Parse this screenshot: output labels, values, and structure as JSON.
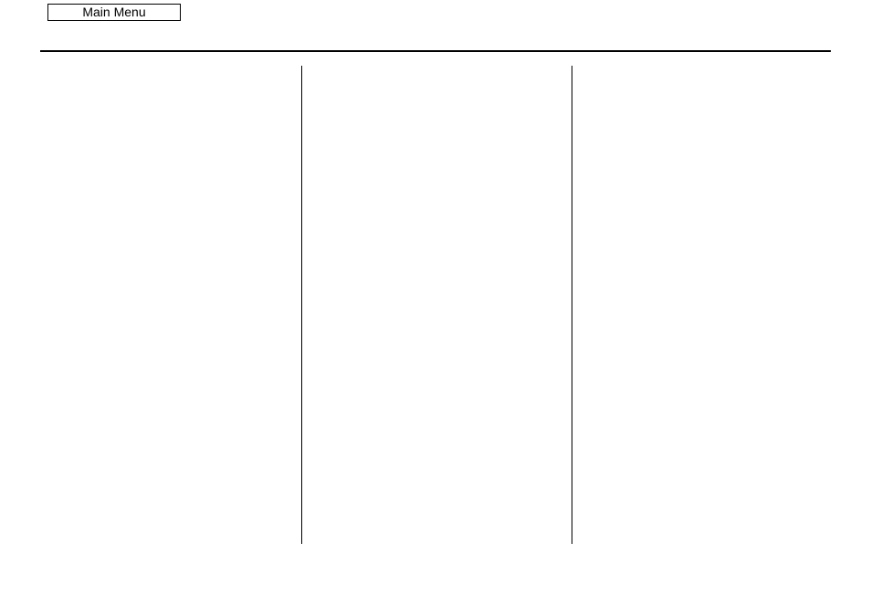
{
  "toolbar": {
    "main_menu_label": "Main Menu"
  }
}
